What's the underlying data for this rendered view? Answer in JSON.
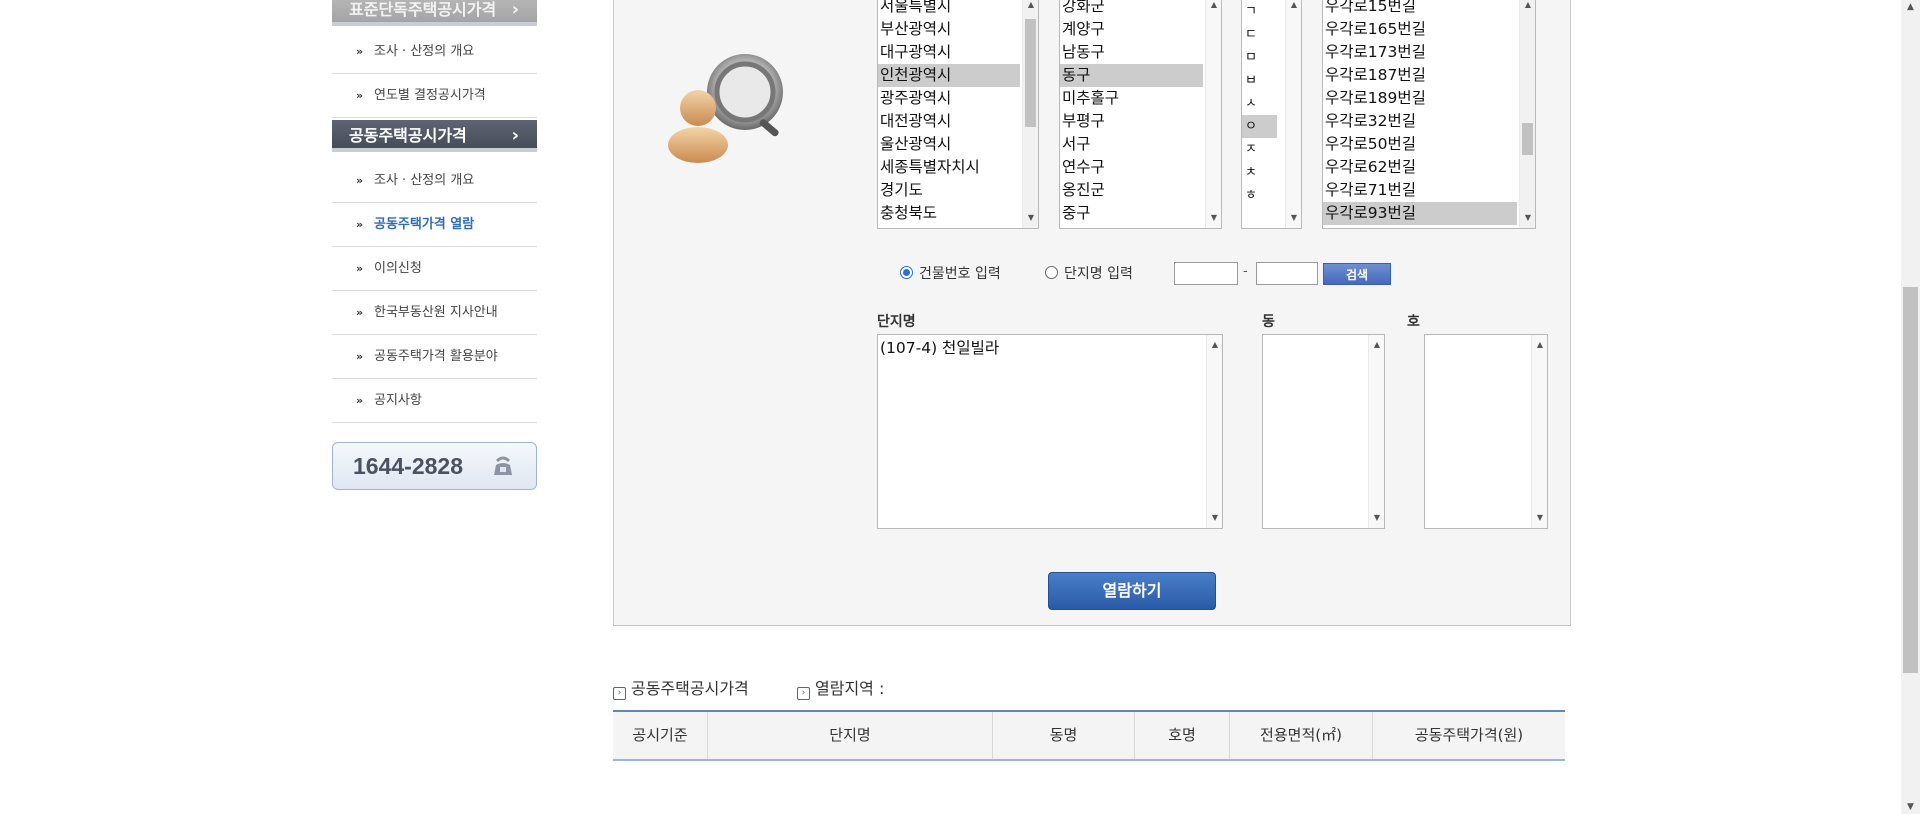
{
  "sidebar": {
    "section1_title": "표준단독주택공시가격",
    "section1_items": [
      "조사 · 산정의 개요",
      "연도별 결정공시가격"
    ],
    "section2_title": "공동주택공시가격",
    "section2_items": [
      "조사 · 산정의 개요",
      "공동주택가격 열람",
      "이의신청",
      "한국부동산원 지사안내",
      "공동주택가격 활용분야",
      "공지사항"
    ],
    "active_item": "공동주택가격 열람",
    "phone": "1644-2828"
  },
  "region": {
    "sido": [
      "서울특별시",
      "부산광역시",
      "대구광역시",
      "인천광역시",
      "광주광역시",
      "대전광역시",
      "울산광역시",
      "세종특별자치시",
      "경기도",
      "충청북도"
    ],
    "sido_selected": "인천광역시",
    "sigungu": [
      "강화군",
      "계양구",
      "남동구",
      "동구",
      "미추홀구",
      "부평구",
      "서구",
      "연수구",
      "옹진군",
      "중구"
    ],
    "sigungu_selected": "동구",
    "initials": [
      "ㄱ",
      "ㄷ",
      "ㅁ",
      "ㅂ",
      "ㅅ",
      "ㅇ",
      "ㅈ",
      "ㅊ",
      "ㅎ"
    ],
    "initial_selected": "ㅇ",
    "roads": [
      "우각로15번길",
      "우각로165번길",
      "우각로173번길",
      "우각로187번길",
      "우각로189번길",
      "우각로32번길",
      "우각로50번길",
      "우각로62번길",
      "우각로71번길",
      "우각로93번길"
    ],
    "road_selected": "우각로93번길"
  },
  "search": {
    "radio_building_label": "건물번호 입력",
    "radio_complex_label": "단지명 입력",
    "building_selected": true,
    "number_main": "",
    "number_sub": "",
    "separator": "-",
    "search_button": "검색"
  },
  "results": {
    "complex_label": "단지명",
    "dong_label": "동",
    "ho_label": "호",
    "complex_items": [
      "(107-4) 천일빌라"
    ],
    "dong_items": [],
    "ho_items": [],
    "view_button": "열람하기"
  },
  "price_section": {
    "title": "공동주택공시가격",
    "region_label": "열람지역 :",
    "columns": [
      "공시기준",
      "단지명",
      "동명",
      "호명",
      "전용면적(㎡)",
      "공동주택가격(원)"
    ]
  },
  "colors": {
    "active_link": "#2f6db5",
    "dark_header": "#4c5260",
    "button_blue": "#2a5aa6",
    "table_border": "#5a88c9"
  }
}
